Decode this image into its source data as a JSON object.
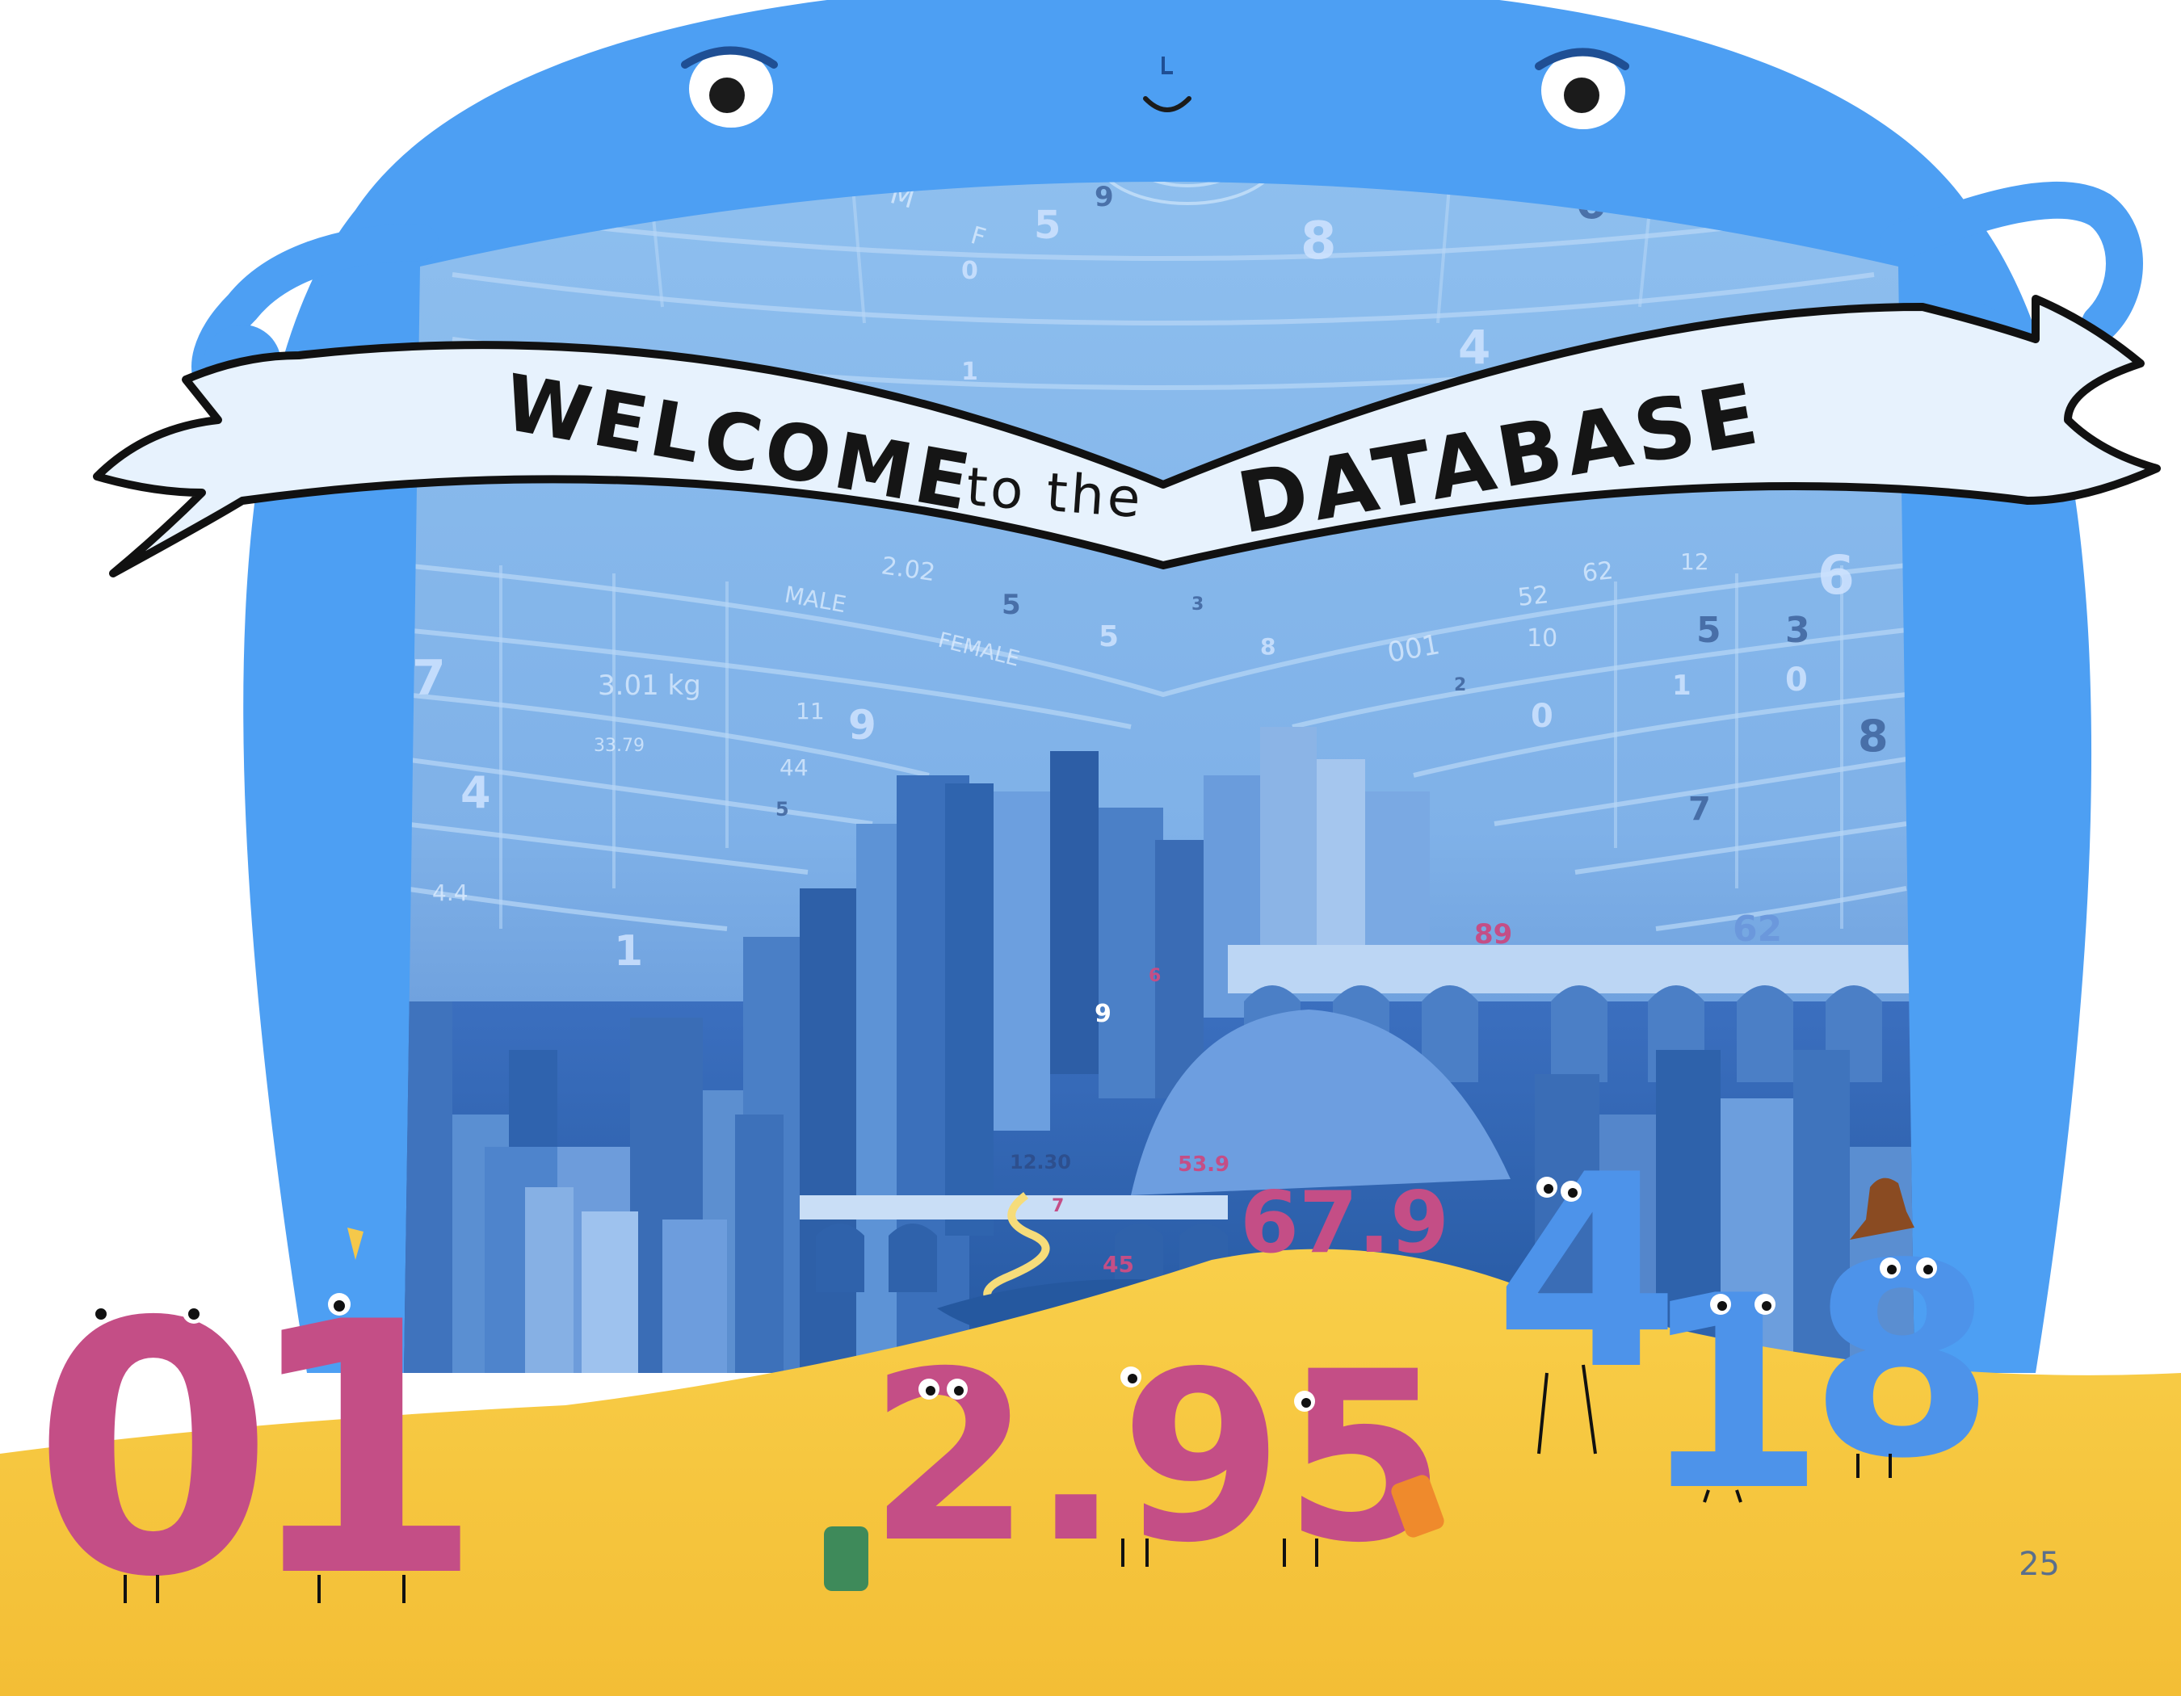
{
  "banner": {
    "word1": "WELCOME",
    "word2": "to the",
    "word3": "DATABASE"
  },
  "wall_text": {
    "labels": [
      "2.02",
      "MALE",
      "FEMALE",
      "3.01 kg",
      "33.79",
      "4.4",
      "001",
      "52",
      "62",
      "10",
      "12",
      "44",
      "11",
      "M",
      "F"
    ],
    "numbers": [
      "9",
      "5",
      "8",
      "6",
      "4",
      "1",
      "7",
      "9",
      "4",
      "5",
      "5",
      "3",
      "8",
      "6",
      "5",
      "3",
      "0",
      "0",
      "1",
      "8",
      "7",
      "2",
      "0",
      "5",
      "1"
    ]
  },
  "city_numbers": {
    "n89": "89",
    "n62": "62",
    "n9": "9",
    "n6": "6",
    "n1230": "12.30",
    "n539": "53.9",
    "n7": "7",
    "n45": "45",
    "n679": "67.9"
  },
  "characters": {
    "left": [
      "0",
      "1"
    ],
    "middle": "2.95",
    "right": [
      "4",
      "1",
      "8"
    ]
  },
  "page_number": "25",
  "colors": {
    "creature": "#4d9ff3",
    "sand": "#f6c63a",
    "pink": "#c44e86",
    "blue_char": "#4d93ea"
  }
}
